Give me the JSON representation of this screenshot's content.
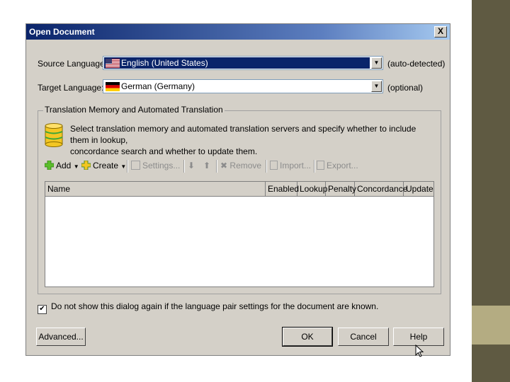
{
  "dialog": {
    "title": "Open Document",
    "close_label": "X"
  },
  "source": {
    "label": "Source Language:",
    "value": "English (United States)",
    "note": "(auto-detected)"
  },
  "target": {
    "label": "Target Language:",
    "value": "German (Germany)",
    "note": "(optional)"
  },
  "tm_group": {
    "title": "Translation Memory and Automated Translation",
    "description_line1": "Select translation memory and automated translation servers and specify whether to include them in lookup,",
    "description_line2": "concordance search and whether to update them."
  },
  "toolbar": {
    "add": "Add",
    "create": "Create",
    "settings": "Settings...",
    "remove": "Remove",
    "import": "Import...",
    "export": "Export..."
  },
  "table": {
    "columns": [
      "Name",
      "Enabled",
      "Lookup",
      "Penalty",
      "Concordance",
      "Update"
    ]
  },
  "option": {
    "checked": true,
    "label": "Do not show this dialog again if the language pair settings for the document are known."
  },
  "buttons": {
    "advanced": "Advanced...",
    "ok": "OK",
    "cancel": "Cancel",
    "help": "Help"
  },
  "colors": {
    "title_bar": "#0a246a",
    "selection": "#0a246a",
    "sidebar_dark": "#5f5a42",
    "sidebar_light": "#b4ac82"
  }
}
